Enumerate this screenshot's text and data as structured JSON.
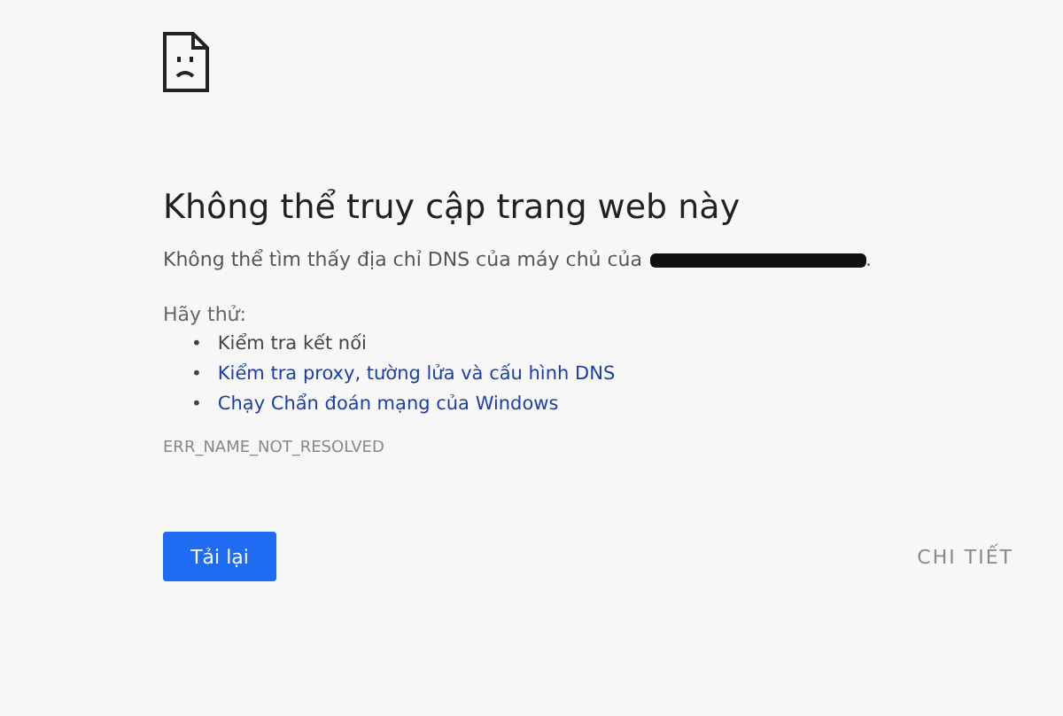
{
  "heading": "Không thể truy cập trang web này",
  "message": {
    "before": "Không thể tìm thấy địa chỉ DNS của máy chủ của",
    "after": ".",
    "redacted": true
  },
  "suggestions_label": "Hãy thử:",
  "suggestions": [
    {
      "marker": "•",
      "text": "Kiểm tra kết nối",
      "kind": "plain"
    },
    {
      "marker": "•",
      "text": "Kiểm tra proxy, tường lửa và cấu hình DNS",
      "kind": "link"
    },
    {
      "marker": "•",
      "text": "Chạy Chẩn đoán mạng của Windows",
      "kind": "link"
    }
  ],
  "error_code": "ERR_NAME_NOT_RESOLVED",
  "buttons": [
    {
      "label": "Tải lại",
      "kind": "primary"
    },
    {
      "label": "CHI TIẾT",
      "kind": "text"
    }
  ]
}
